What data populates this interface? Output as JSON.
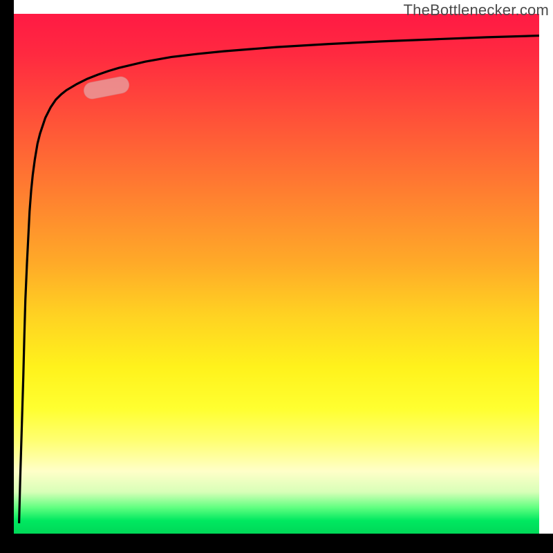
{
  "watermark": {
    "text": "TheBottlenecker.com"
  },
  "colors": {
    "curve": "#000000",
    "highlight_fill": "#e8a0a0",
    "highlight_stroke": "#d88888",
    "axis": "#000000"
  },
  "chart_data": {
    "type": "line",
    "title": "",
    "xlabel": "",
    "ylabel": "",
    "xlim": [
      0,
      100
    ],
    "ylim": [
      0,
      100
    ],
    "grid": false,
    "legend": false,
    "annotations": [
      {
        "kind": "pill-highlight",
        "x_range": [
          13.0,
          21.5
        ],
        "y_range": [
          83.5,
          87.5
        ]
      }
    ],
    "series": [
      {
        "name": "bottleneck-curve",
        "x": [
          1.0,
          1.2,
          1.5,
          1.8,
          2.0,
          2.2,
          2.5,
          2.8,
          3.0,
          3.3,
          3.6,
          4.0,
          4.5,
          5.0,
          5.5,
          6.0,
          7.0,
          8.0,
          9.0,
          10.0,
          12.0,
          14.0,
          16.0,
          18.0,
          20.0,
          25.0,
          30.0,
          35.0,
          40.0,
          45.0,
          50.0,
          60.0,
          70.0,
          80.0,
          90.0,
          100.0
        ],
        "y": [
          2.0,
          10.0,
          20.0,
          30.0,
          38.0,
          45.0,
          52.0,
          58.0,
          62.0,
          66.0,
          69.0,
          72.0,
          75.0,
          77.0,
          78.5,
          80.0,
          82.0,
          83.5,
          84.5,
          85.3,
          86.5,
          87.5,
          88.3,
          89.0,
          89.6,
          90.8,
          91.7,
          92.3,
          92.8,
          93.2,
          93.6,
          94.2,
          94.7,
          95.1,
          95.5,
          95.8
        ]
      }
    ]
  }
}
